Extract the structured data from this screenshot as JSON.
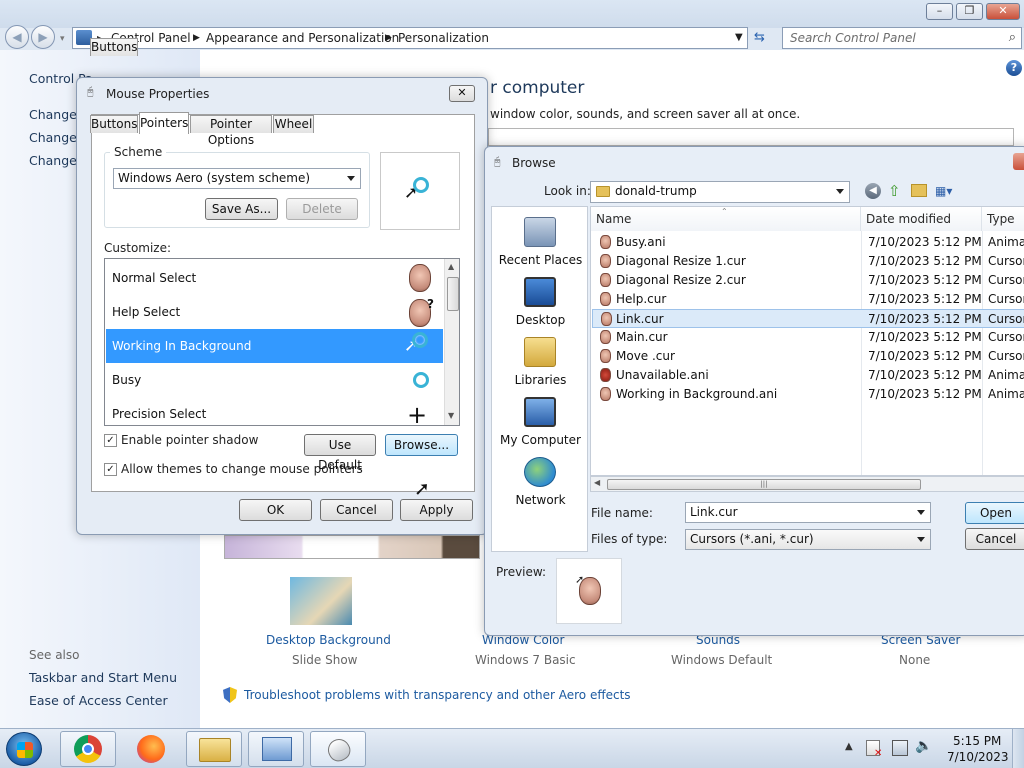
{
  "control_panel": {
    "breadcrumbs": [
      "Control Panel",
      "Appearance and Personalization",
      "Personalization"
    ],
    "search_placeholder": "Search Control Panel",
    "left_links": [
      "Control Pa",
      "Change",
      "Change",
      "Change y"
    ],
    "heading_partial": "r computer",
    "description_partial": "window color, sounds, and screen saver all at once.",
    "see_also": "See also",
    "see_also_links": [
      "Taskbar and Start Menu",
      "Ease of Access Center"
    ],
    "bottom_items": [
      {
        "label": "Desktop Background",
        "value": "Slide Show"
      },
      {
        "label": "Window Color",
        "value": "Windows 7 Basic"
      },
      {
        "label": "Sounds",
        "value": "Windows Default"
      },
      {
        "label": "Screen Saver",
        "value": "None"
      }
    ],
    "troubleshoot_link": "Troubleshoot problems with transparency and other Aero effects"
  },
  "mouse_properties": {
    "title": "Mouse Properties",
    "tabs": [
      "Buttons",
      "Pointers",
      "Pointer Options",
      "Wheel"
    ],
    "active_tab": "Pointers",
    "scheme_label": "Scheme",
    "scheme_value": "Windows Aero (system scheme)",
    "save_as": "Save As...",
    "delete": "Delete",
    "customize_label": "Customize:",
    "cursors": [
      "Normal Select",
      "Help Select",
      "Working In Background",
      "Busy",
      "Precision Select"
    ],
    "selected_cursor": "Working In Background",
    "enable_shadow": "Enable pointer shadow",
    "allow_themes": "Allow themes to change mouse pointers",
    "use_default": "Use Default",
    "browse": "Browse...",
    "ok": "OK",
    "cancel": "Cancel",
    "apply": "Apply"
  },
  "browse": {
    "title": "Browse",
    "look_in_label": "Look in:",
    "look_in_value": "donald-trump",
    "places": [
      "Recent Places",
      "Desktop",
      "Libraries",
      "My Computer",
      "Network"
    ],
    "columns": [
      "Name",
      "Date modified",
      "Type"
    ],
    "files": [
      {
        "name": "Busy.ani",
        "date": "7/10/2023 5:12 PM",
        "type": "Animat"
      },
      {
        "name": "Diagonal Resize 1.cur",
        "date": "7/10/2023 5:12 PM",
        "type": "Cursor"
      },
      {
        "name": "Diagonal Resize 2.cur",
        "date": "7/10/2023 5:12 PM",
        "type": "Cursor"
      },
      {
        "name": "Help.cur",
        "date": "7/10/2023 5:12 PM",
        "type": "Cursor"
      },
      {
        "name": "Link.cur",
        "date": "7/10/2023 5:12 PM",
        "type": "Cursor"
      },
      {
        "name": "Main.cur",
        "date": "7/10/2023 5:12 PM",
        "type": "Cursor"
      },
      {
        "name": "Move .cur",
        "date": "7/10/2023 5:12 PM",
        "type": "Cursor"
      },
      {
        "name": "Unavailable.ani",
        "date": "7/10/2023 5:12 PM",
        "type": "Animat"
      },
      {
        "name": "Working in Background.ani",
        "date": "7/10/2023 5:12 PM",
        "type": "Animat"
      }
    ],
    "selected_file": "Link.cur",
    "file_name_label": "File name:",
    "file_name_value": "Link.cur",
    "files_of_type_label": "Files of type:",
    "files_of_type_value": "Cursors (*.ani, *.cur)",
    "open": "Open",
    "cancel": "Cancel",
    "preview_label": "Preview:"
  },
  "taskbar": {
    "time": "5:15 PM",
    "date": "7/10/2023"
  },
  "colors": {
    "selection": "#3399ff",
    "link": "#1c5aa0"
  }
}
